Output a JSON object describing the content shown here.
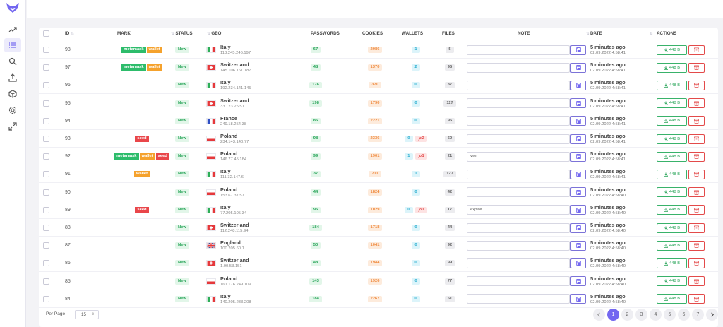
{
  "colors": {
    "accent": "#7367f0",
    "green": "#2dbc6b",
    "orange": "#f5a22d",
    "red": "#e9464a",
    "cyan": "#2aaed0"
  },
  "sidebar": {
    "logo": "fox-logo-icon",
    "items": [
      {
        "name": "trending-icon"
      },
      {
        "name": "list-icon",
        "active": true
      },
      {
        "name": "search-icon"
      },
      {
        "name": "upload-icon"
      },
      {
        "name": "box-icon"
      },
      {
        "name": "gear-icon"
      },
      {
        "name": "expand-icon"
      }
    ]
  },
  "table": {
    "headers": {
      "id": "ID",
      "mark": "MARK",
      "status": "STATUS",
      "geo": "GEO",
      "passwords": "PASSWORDS",
      "cookies": "COOKIES",
      "wallets": "WALLETS",
      "files": "FILES",
      "note": "NOTE",
      "date": "DATE",
      "actions": "ACTIONS"
    },
    "rows": [
      {
        "id": "98",
        "marks": [
          "metamask",
          "wallet"
        ],
        "status": "New",
        "flag": "it",
        "country": "Italy",
        "ip": "118.245.246.197",
        "passwords": "67",
        "cookies": "2086",
        "wallets": "1",
        "wallets_extra": "",
        "files": "5",
        "note": "",
        "ago": "5 minutes ago",
        "ts": "02.09.2022 4:58:41",
        "size": "448 B"
      },
      {
        "id": "97",
        "marks": [
          "metamask",
          "wallet"
        ],
        "status": "New",
        "flag": "ch",
        "country": "Switzerland",
        "ip": "145.106.161.187",
        "passwords": "48",
        "cookies": "1370",
        "wallets": "2",
        "wallets_extra": "",
        "files": "95",
        "note": "",
        "ago": "5 minutes ago",
        "ts": "02.09.2022 4:58:41",
        "size": "448 B"
      },
      {
        "id": "96",
        "marks": [],
        "status": "New",
        "flag": "it",
        "country": "Italy",
        "ip": "192.234.141.145",
        "passwords": "176",
        "cookies": "370",
        "wallets": "0",
        "wallets_extra": "",
        "files": "37",
        "note": "",
        "ago": "5 minutes ago",
        "ts": "02.09.2022 4:58:41",
        "size": "448 B"
      },
      {
        "id": "95",
        "marks": [],
        "status": "New",
        "flag": "ch",
        "country": "Switzerland",
        "ip": "33.123.25.51",
        "passwords": "198",
        "cookies": "1790",
        "wallets": "0",
        "wallets_extra": "",
        "files": "117",
        "note": "",
        "ago": "5 minutes ago",
        "ts": "02.09.2022 4:58:41",
        "size": "448 B"
      },
      {
        "id": "94",
        "marks": [],
        "status": "New",
        "flag": "fr",
        "country": "France",
        "ip": "249.18.254.38",
        "passwords": "85",
        "cookies": "2221",
        "wallets": "0",
        "wallets_extra": "",
        "files": "95",
        "note": "",
        "ago": "5 minutes ago",
        "ts": "02.09.2022 4:58:41",
        "size": "448 B"
      },
      {
        "id": "93",
        "marks": [
          "seed"
        ],
        "status": "New",
        "flag": "pl",
        "country": "Poland",
        "ip": "234.143.140.77",
        "passwords": "98",
        "cookies": "2336",
        "wallets": "0",
        "wallets_extra": "2",
        "files": "60",
        "note": "",
        "ago": "5 minutes ago",
        "ts": "02.09.2022 4:58:41",
        "size": "448 B"
      },
      {
        "id": "92",
        "marks": [
          "metamask",
          "wallet",
          "seed"
        ],
        "status": "New",
        "flag": "pl",
        "country": "Poland",
        "ip": "146.77.45.184",
        "passwords": "99",
        "cookies": "1901",
        "wallets": "1",
        "wallets_extra": "1",
        "files": "21",
        "note": "xss",
        "ago": "5 minutes ago",
        "ts": "02.09.2022 4:58:41",
        "size": "448 B"
      },
      {
        "id": "91",
        "marks": [
          "wallet"
        ],
        "status": "New",
        "flag": "it",
        "country": "Italy",
        "ip": "111.32.147.6",
        "passwords": "37",
        "cookies": "711",
        "wallets": "1",
        "wallets_extra": "",
        "files": "127",
        "note": "",
        "ago": "5 minutes ago",
        "ts": "02.09.2022 4:58:41",
        "size": "448 B"
      },
      {
        "id": "90",
        "marks": [],
        "status": "New",
        "flag": "pl",
        "country": "Poland",
        "ip": "153.67.37.57",
        "passwords": "44",
        "cookies": "1824",
        "wallets": "0",
        "wallets_extra": "",
        "files": "42",
        "note": "",
        "ago": "5 minutes ago",
        "ts": "02.09.2022 4:58:40",
        "size": "448 B"
      },
      {
        "id": "89",
        "marks": [
          "seed"
        ],
        "status": "New",
        "flag": "it",
        "country": "Italy",
        "ip": "77.205.105.34",
        "passwords": "95",
        "cookies": "1029",
        "wallets": "0",
        "wallets_extra": "1",
        "files": "17",
        "note": "exploit",
        "ago": "5 minutes ago",
        "ts": "02.09.2022 4:58:40",
        "size": "448 B"
      },
      {
        "id": "88",
        "marks": [],
        "status": "New",
        "flag": "ch",
        "country": "Switzerland",
        "ip": "112.248.115.94",
        "passwords": "184",
        "cookies": "1718",
        "wallets": "0",
        "wallets_extra": "",
        "files": "44",
        "note": "",
        "ago": "5 minutes ago",
        "ts": "02.09.2022 4:58:40",
        "size": "448 B"
      },
      {
        "id": "87",
        "marks": [],
        "status": "New",
        "flag": "gb",
        "country": "England",
        "ip": "100.205.60.1",
        "passwords": "50",
        "cookies": "1041",
        "wallets": "0",
        "wallets_extra": "",
        "files": "92",
        "note": "",
        "ago": "5 minutes ago",
        "ts": "02.09.2022 4:58:40",
        "size": "448 B"
      },
      {
        "id": "86",
        "marks": [],
        "status": "New",
        "flag": "ch",
        "country": "Switzerland",
        "ip": "1.90.53.151",
        "passwords": "48",
        "cookies": "1944",
        "wallets": "0",
        "wallets_extra": "",
        "files": "99",
        "note": "",
        "ago": "5 minutes ago",
        "ts": "02.09.2022 4:58:40",
        "size": "448 B"
      },
      {
        "id": "85",
        "marks": [],
        "status": "New",
        "flag": "pl",
        "country": "Poland",
        "ip": "161.176.249.109",
        "passwords": "143",
        "cookies": "1926",
        "wallets": "0",
        "wallets_extra": "",
        "files": "77",
        "note": "",
        "ago": "5 minutes ago",
        "ts": "02.09.2022 4:58:40",
        "size": "448 B"
      },
      {
        "id": "84",
        "marks": [],
        "status": "New",
        "flag": "it",
        "country": "Italy",
        "ip": "140.205.233.208",
        "passwords": "184",
        "cookies": "2267",
        "wallets": "0",
        "wallets_extra": "",
        "files": "61",
        "note": "",
        "ago": "5 minutes ago",
        "ts": "02.09.2022 4:58:40",
        "size": "448 B"
      }
    ]
  },
  "footer": {
    "per_page_label": "Per Page",
    "per_page_value": "15",
    "pages": [
      "1",
      "2",
      "3",
      "4",
      "5",
      "6",
      "7"
    ],
    "current_page": "1"
  }
}
